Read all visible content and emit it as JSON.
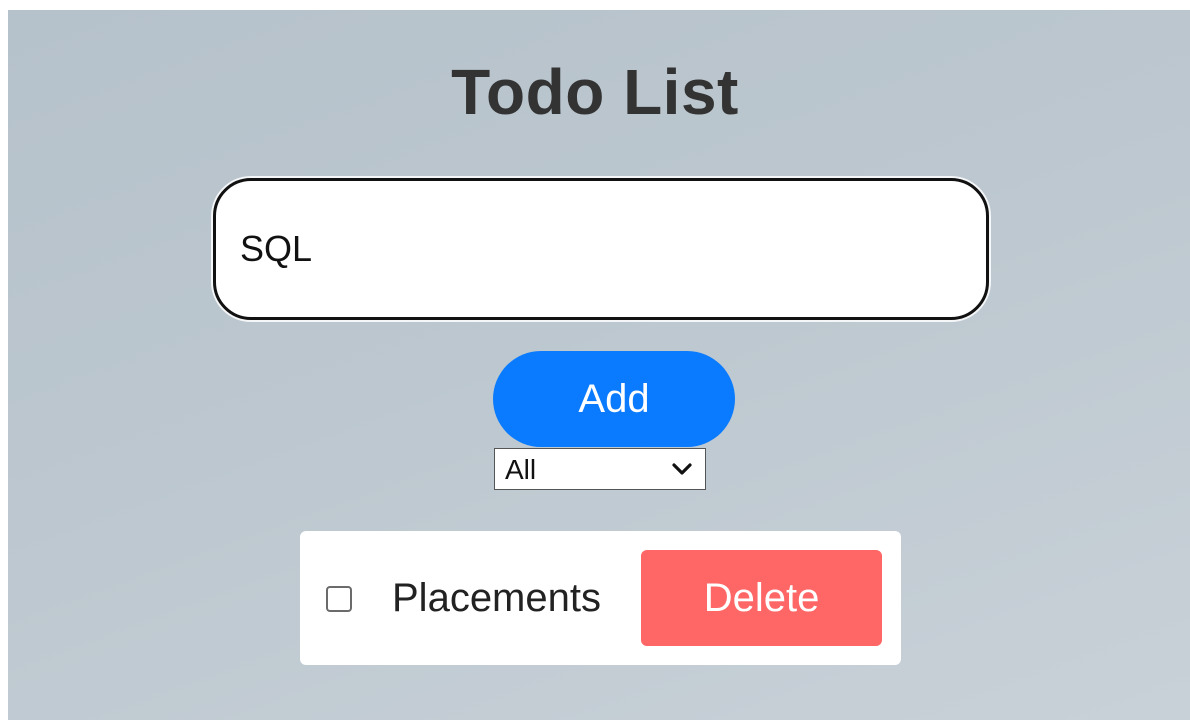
{
  "app": {
    "title": "Todo List"
  },
  "input": {
    "value": "SQL",
    "placeholder": ""
  },
  "add_button": {
    "label": "Add",
    "color": "#0a7bff"
  },
  "filter": {
    "selected": "All",
    "options": [
      "All"
    ]
  },
  "todos": [
    {
      "text": "Placements",
      "completed": false,
      "delete_label": "Delete"
    }
  ],
  "colors": {
    "background": "#bcc7cf",
    "delete": "#ff6666",
    "title": "#333333"
  },
  "icons": {
    "filter_chevron": "chevron-down-icon",
    "todo_checkbox": "checkbox-unchecked-icon"
  }
}
